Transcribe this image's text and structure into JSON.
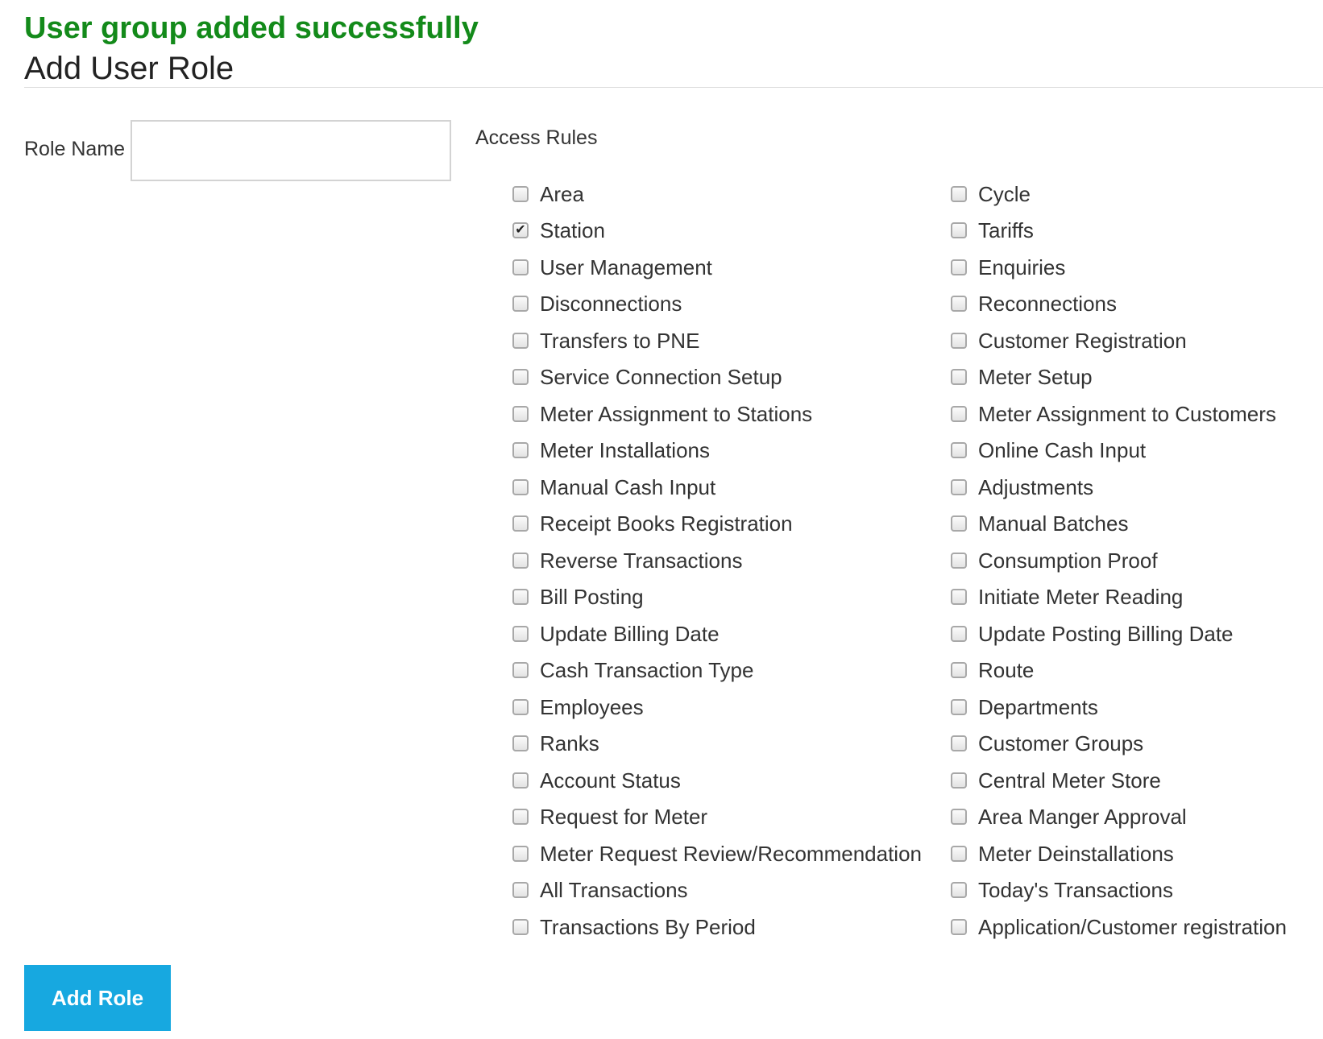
{
  "alert": {
    "message": "User group added successfully",
    "color": "#138a1a"
  },
  "page": {
    "title": "Add User Role"
  },
  "form": {
    "role_name_label": "Role Name",
    "role_name_value": "",
    "access_rules_label": "Access Rules",
    "submit_label": "Add Role",
    "submit_color": "#17a8e0"
  },
  "access_rules": {
    "left": [
      {
        "label": "Area",
        "checked": false
      },
      {
        "label": "Station",
        "checked": true
      },
      {
        "label": "User Management",
        "checked": false
      },
      {
        "label": "Disconnections",
        "checked": false
      },
      {
        "label": "Transfers to PNE",
        "checked": false
      },
      {
        "label": "Service Connection Setup",
        "checked": false
      },
      {
        "label": "Meter Assignment to Stations",
        "checked": false
      },
      {
        "label": "Meter Installations",
        "checked": false
      },
      {
        "label": "Manual Cash Input",
        "checked": false
      },
      {
        "label": "Receipt Books Registration",
        "checked": false
      },
      {
        "label": "Reverse Transactions",
        "checked": false
      },
      {
        "label": "Bill Posting",
        "checked": false
      },
      {
        "label": "Update Billing Date",
        "checked": false
      },
      {
        "label": "Cash Transaction Type",
        "checked": false
      },
      {
        "label": "Employees",
        "checked": false
      },
      {
        "label": "Ranks",
        "checked": false
      },
      {
        "label": "Account Status",
        "checked": false
      },
      {
        "label": "Request for Meter",
        "checked": false
      },
      {
        "label": "Meter Request Review/Recommendation",
        "checked": false
      },
      {
        "label": "All Transactions",
        "checked": false
      },
      {
        "label": "Transactions By Period",
        "checked": false
      }
    ],
    "right": [
      {
        "label": "Cycle",
        "checked": false
      },
      {
        "label": "Tariffs",
        "checked": false
      },
      {
        "label": "Enquiries",
        "checked": false
      },
      {
        "label": "Reconnections",
        "checked": false
      },
      {
        "label": "Customer Registration",
        "checked": false
      },
      {
        "label": "Meter Setup",
        "checked": false
      },
      {
        "label": "Meter Assignment to Customers",
        "checked": false
      },
      {
        "label": "Online Cash Input",
        "checked": false
      },
      {
        "label": "Adjustments",
        "checked": false
      },
      {
        "label": "Manual Batches",
        "checked": false
      },
      {
        "label": "Consumption Proof",
        "checked": false
      },
      {
        "label": "Initiate Meter Reading",
        "checked": false
      },
      {
        "label": "Update Posting Billing Date",
        "checked": false
      },
      {
        "label": "Route",
        "checked": false
      },
      {
        "label": "Departments",
        "checked": false
      },
      {
        "label": "Customer Groups",
        "checked": false
      },
      {
        "label": "Central Meter Store",
        "checked": false
      },
      {
        "label": "Area Manger Approval",
        "checked": false
      },
      {
        "label": "Meter Deinstallations",
        "checked": false
      },
      {
        "label": "Today's Transactions",
        "checked": false
      },
      {
        "label": "Application/Customer registration",
        "checked": false
      }
    ]
  }
}
